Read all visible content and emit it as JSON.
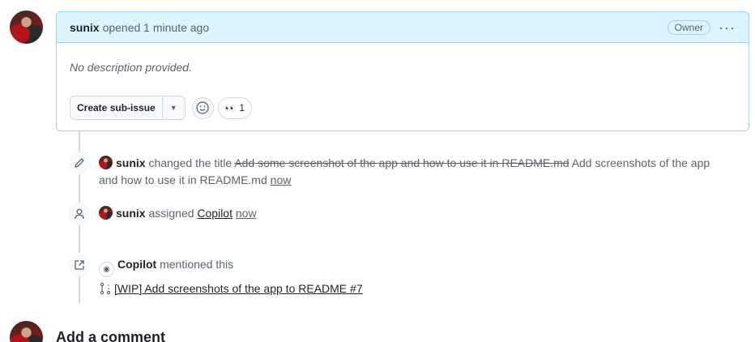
{
  "comment": {
    "author": "sunix",
    "opened_text": "opened 1 minute ago",
    "role_badge": "Owner",
    "kebab": "···",
    "body": "No description provided.",
    "create_subissue_label": "Create sub-issue",
    "reaction_emoji": "👀",
    "reaction_count": "1"
  },
  "timeline": {
    "rename": {
      "actor": "sunix",
      "verb": "changed the title",
      "old_title": "Add some screenshot of the app and how to use it in README.md",
      "new_title": "Add screenshots of the app and how to use it in README.md",
      "time": "now"
    },
    "assign": {
      "actor": "sunix",
      "verb": "assigned",
      "assignee": "Copilot",
      "time": "now"
    },
    "mention": {
      "actor": "Copilot",
      "verb": "mentioned this",
      "pr_title": "[WIP] Add screenshots of the app to README #7"
    }
  },
  "footer": {
    "add_comment": "Add a comment"
  }
}
